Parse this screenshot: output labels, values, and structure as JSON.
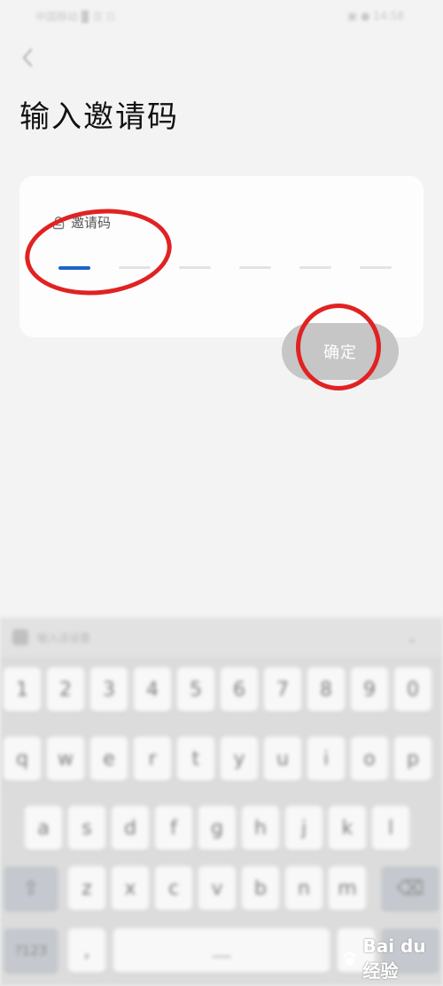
{
  "status_bar": {
    "left_text": "中国移动 ▉ ☰ ☷",
    "right_text": "▣ ● 14:58"
  },
  "page": {
    "title": "输入邀请码"
  },
  "card": {
    "label": "邀请码",
    "slot_count": 6,
    "active_slot": 0
  },
  "confirm_button": {
    "label": "确定"
  },
  "keyboard": {
    "toolbar_text": "输入法设置",
    "rows": [
      [
        "1",
        "2",
        "3",
        "4",
        "5",
        "6",
        "7",
        "8",
        "9",
        "0"
      ],
      [
        "q",
        "w",
        "e",
        "r",
        "t",
        "y",
        "u",
        "i",
        "o",
        "p"
      ],
      [
        "a",
        "s",
        "d",
        "f",
        "g",
        "h",
        "j",
        "k",
        "l"
      ],
      [
        "z",
        "x",
        "c",
        "v",
        "b",
        "n",
        "m"
      ]
    ],
    "shift_label": "⇧",
    "backspace_label": "⌫",
    "symbols_label": "?123",
    "comma_label": ",",
    "space_label": "___"
  },
  "watermark": {
    "text": "Bai du 经验"
  }
}
